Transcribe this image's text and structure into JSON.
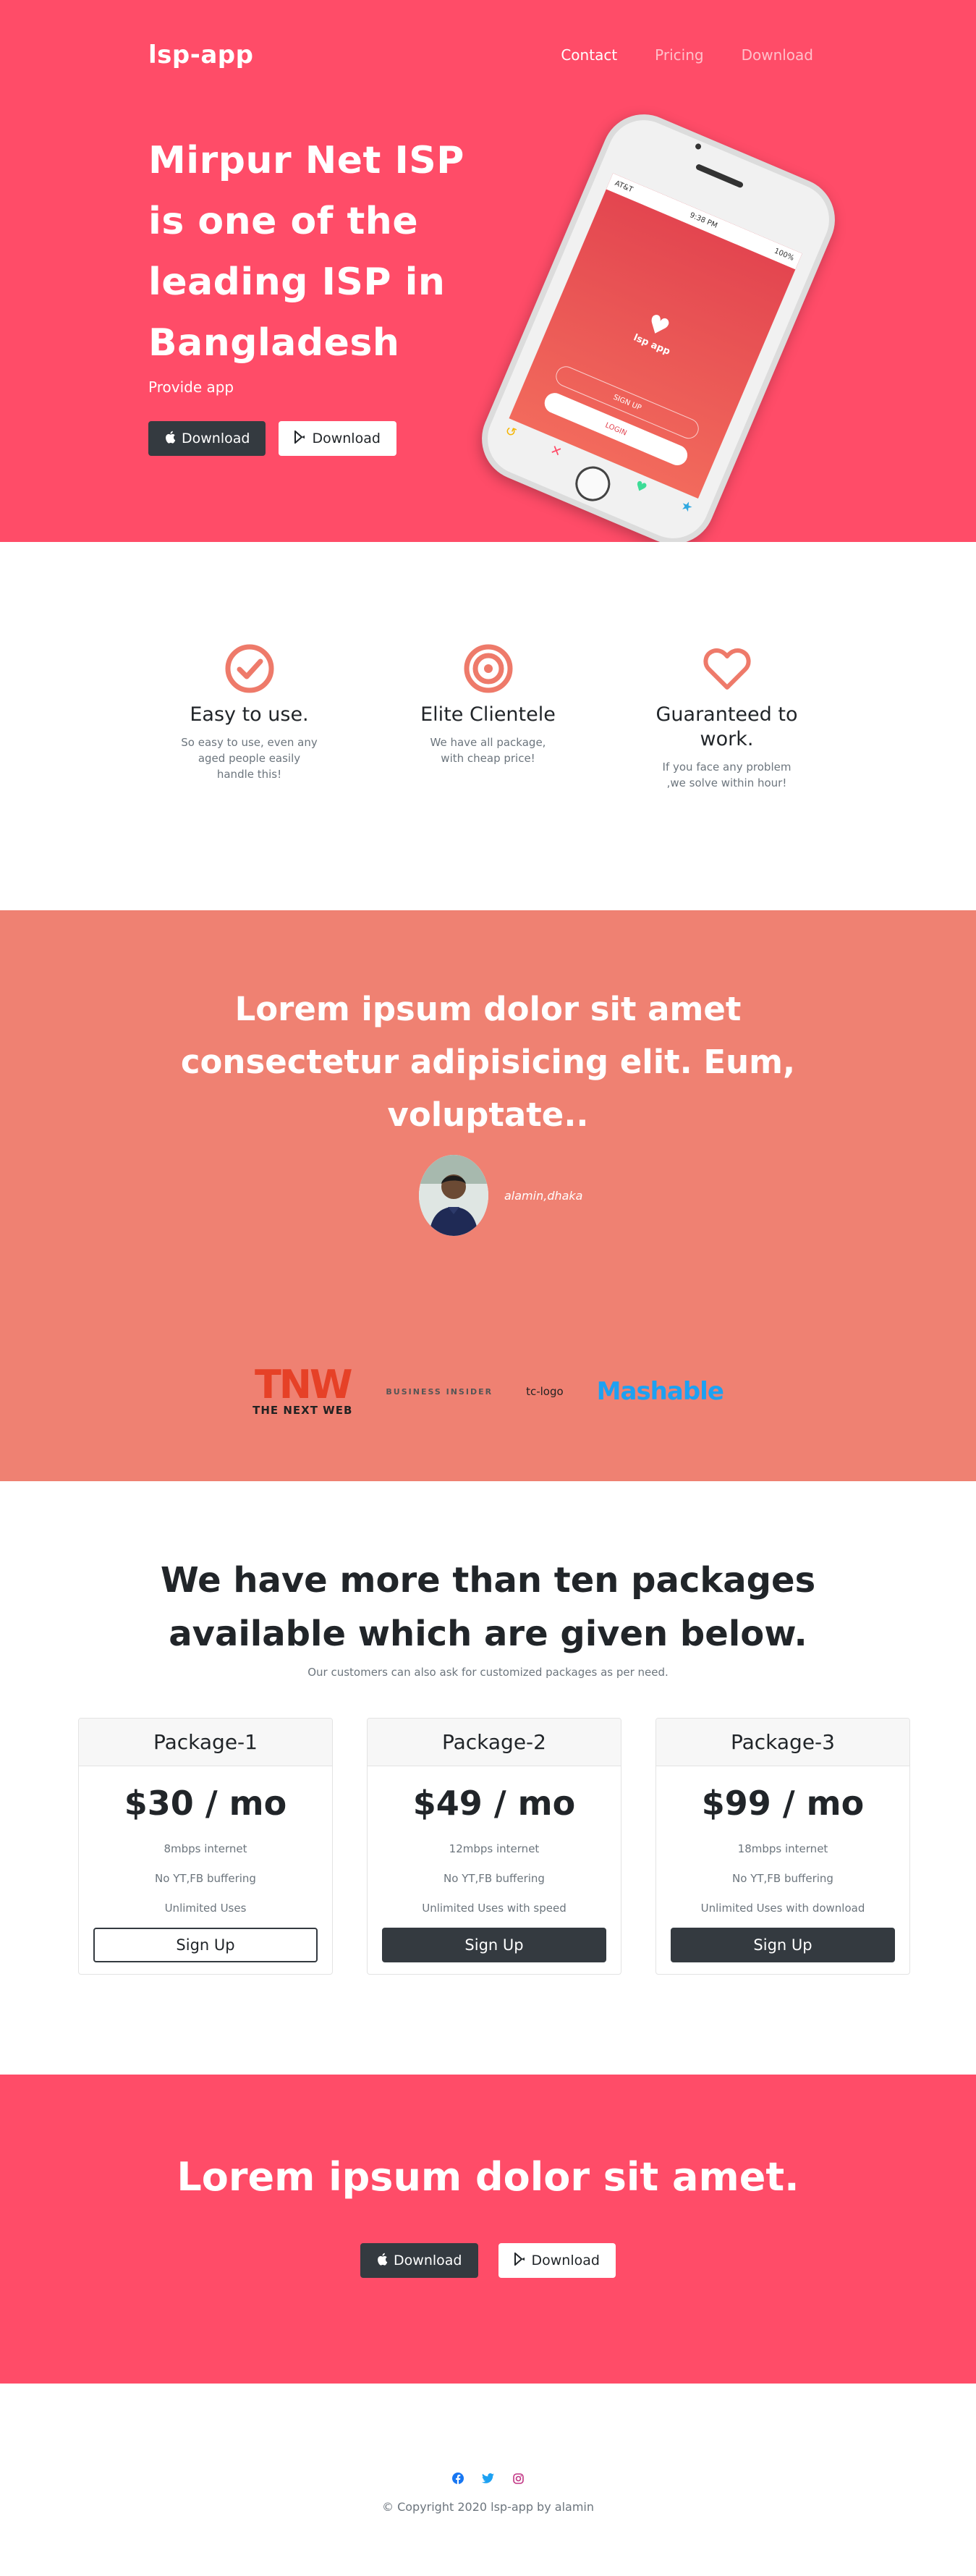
{
  "nav": {
    "brand": "lsp-app",
    "links": [
      "Contact",
      "Pricing",
      "Download"
    ]
  },
  "hero": {
    "title": "Mirpur Net ISP is one of the leading ISP in Bangladesh",
    "subtitle": "Provide app",
    "apple_button": "Download",
    "play_button": "Download",
    "phone": {
      "carrier": "AT&T",
      "time": "9:38 PM",
      "battery": "100%",
      "app_name": "lsp app",
      "signup": "SIGN UP",
      "login": "LOGIN"
    }
  },
  "features": [
    {
      "icon": "check-circle-icon",
      "title": "Easy to use.",
      "text": "So easy to use, even any aged people easily handle this!"
    },
    {
      "icon": "bullseye-icon",
      "title": "Elite Clientele",
      "text": "We have all package, with cheap price!"
    },
    {
      "icon": "heart-icon",
      "title": "Guaranteed to work.",
      "text": "If you face any problem ,we solve within hour!"
    }
  ],
  "testimonial": {
    "quote": "Lorem ipsum dolor sit amet consectetur adipisicing elit. Eum, voluptate..",
    "author": "alamin,dhaka",
    "logos": {
      "tnw_mark": "TNW",
      "tnw_text": "THE NEXT WEB",
      "business_insider": "BUSINESS INSIDER",
      "tc": "tc-logo",
      "mashable": "Mashable"
    }
  },
  "pricing": {
    "title": "We have more than ten packages available which are given below.",
    "subtitle": "Our customers can also ask for customized packages as per need.",
    "packages": [
      {
        "name": "Package-1",
        "price": "$30 / mo",
        "features": [
          "8mbps internet",
          "No YT,FB buffering",
          "Unlimited Uses"
        ],
        "button": "Sign Up"
      },
      {
        "name": "Package-2",
        "price": "$49 / mo",
        "features": [
          "12mbps internet",
          "No YT,FB buffering",
          "Unlimited Uses with speed"
        ],
        "button": "Sign Up"
      },
      {
        "name": "Package-3",
        "price": "$99 / mo",
        "features": [
          "18mbps internet",
          "No YT,FB buffering",
          "Unlimited Uses with download"
        ],
        "button": "Sign Up"
      }
    ]
  },
  "cta": {
    "title": "Lorem ipsum dolor sit amet.",
    "apple_button": "Download",
    "play_button": "Download"
  },
  "footer": {
    "social": [
      "facebook-icon",
      "twitter-icon",
      "instagram-icon"
    ],
    "copyright": "© Copyright 2020 lsp-app by alamin"
  },
  "colors": {
    "primary": "#ff4c68",
    "salmon": "#ef8172",
    "dark": "#343a40",
    "icon_accent": "#ee7a6a"
  }
}
